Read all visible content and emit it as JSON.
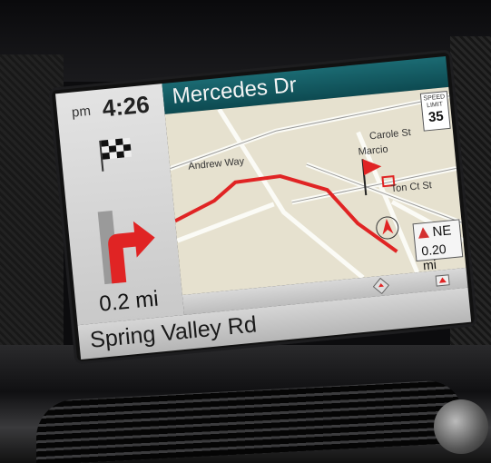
{
  "nav": {
    "time_period": "pm",
    "time": "4:26",
    "distance_to_turn": "0.2 mi",
    "street": "Mercedes Dr",
    "current_road": "Spring Valley Rd",
    "speed_limit_caption": "SPEED LIMIT",
    "speed_limit": "35",
    "heading": "NE",
    "heading_distance": "0.20 mi",
    "map_labels": [
      "Andrew Way",
      "Carole St",
      "Marcio",
      "Ton Ct St"
    ]
  },
  "colors": {
    "header": "#1b6a72",
    "route": "#e02424",
    "map": "#e6e1cf"
  }
}
